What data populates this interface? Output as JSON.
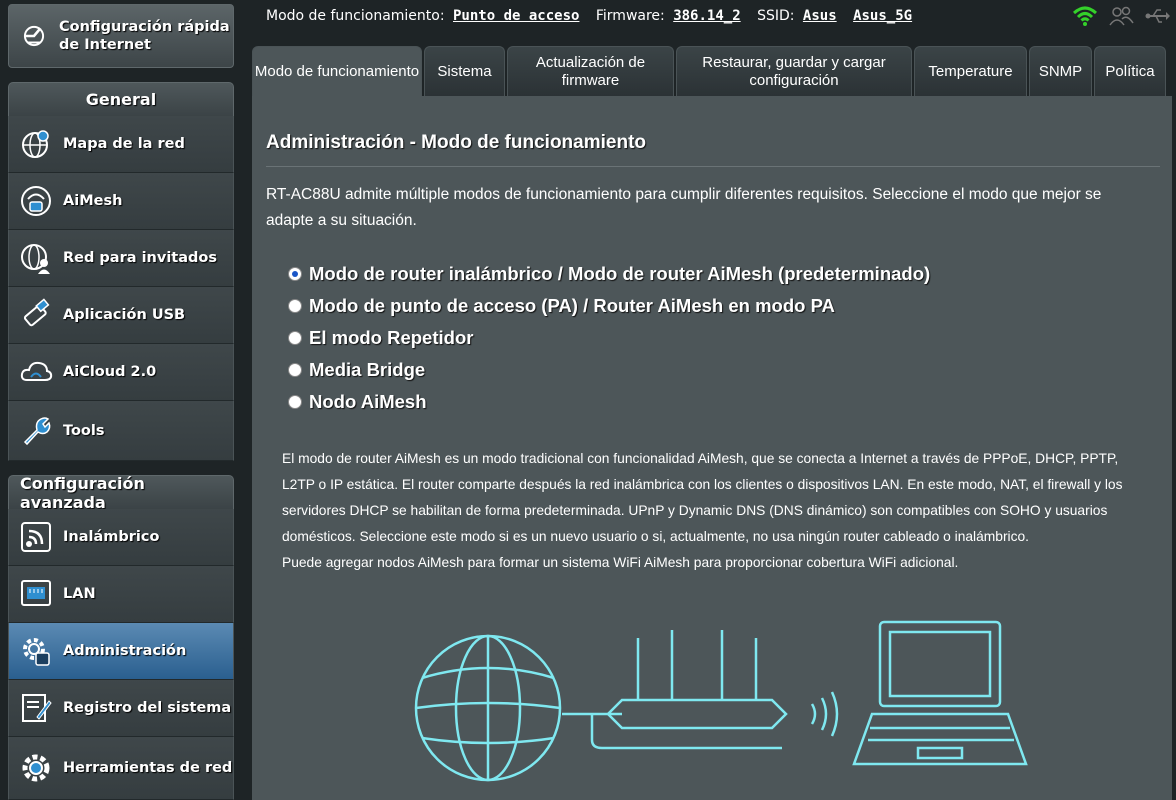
{
  "sidebar": {
    "quick_setup": "Configuración rápida de Internet",
    "general_header": "General",
    "general_items": [
      {
        "label": "Mapa de la red",
        "icon": "network-map-icon"
      },
      {
        "label": "AiMesh",
        "icon": "aimesh-icon"
      },
      {
        "label": "Red para invitados",
        "icon": "guest-network-icon"
      },
      {
        "label": "Aplicación USB",
        "icon": "usb-icon"
      },
      {
        "label": "AiCloud 2.0",
        "icon": "cloud-icon"
      },
      {
        "label": "Tools",
        "icon": "wrench-icon"
      }
    ],
    "advanced_header": "Configuración avanzada",
    "advanced_items": [
      {
        "label": "Inalámbrico",
        "icon": "wireless-icon"
      },
      {
        "label": "LAN",
        "icon": "lan-icon"
      },
      {
        "label": "Administración",
        "icon": "admin-icon",
        "active": true
      },
      {
        "label": "Registro del sistema",
        "icon": "system-log-icon"
      },
      {
        "label": "Herramientas de red",
        "icon": "network-tools-icon"
      }
    ]
  },
  "topbar": {
    "mode_label": "Modo de funcionamiento:",
    "mode_value": "Punto de acceso",
    "firmware_label": "Firmware:",
    "firmware_value": "386.14_2",
    "ssid_label": "SSID:",
    "ssid_1": "Asus",
    "ssid_2": "Asus_5G"
  },
  "tabs": [
    {
      "label": "Modo de funcionamiento",
      "active": true
    },
    {
      "label": "Sistema"
    },
    {
      "label": "Actualización de firmware"
    },
    {
      "label": "Restaurar, guardar y cargar configuración"
    },
    {
      "label": "Temperature"
    },
    {
      "label": "SNMP"
    },
    {
      "label": "Política"
    }
  ],
  "main": {
    "title": "Administración - Modo de funcionamiento",
    "description": "RT-AC88U admite múltiple modos de funcionamiento para cumplir diferentes requisitos. Seleccione el modo que mejor se adapte a su situación.",
    "modes": [
      {
        "label": "Modo de router inalámbrico / Modo de router AiMesh (predeterminado)",
        "checked": true
      },
      {
        "label": "Modo de punto de acceso (PA) / Router AiMesh en modo PA",
        "checked": false
      },
      {
        "label": "El modo Repetidor",
        "checked": false
      },
      {
        "label": "Media Bridge",
        "checked": false
      },
      {
        "label": "Nodo AiMesh",
        "checked": false
      }
    ],
    "mode_description": "El modo de router AiMesh es un modo tradicional con funcionalidad AiMesh, que se conecta a Internet a través de PPPoE, DHCP, PPTP, L2TP o IP estática. El router comparte después la red inalámbrica con los clientes o dispositivos LAN. En este modo, NAT, el firewall y los servidores DHCP se habilitan de forma predeterminada. UPnP y Dynamic DNS (DNS dinámico) son compatibles con SOHO y usuarios domésticos. Seleccione este modo si es un nuevo usuario o si, actualmente, no usa ningún router cableado o inalámbrico.",
    "mode_description_2": "Puede agregar nodos AiMesh para formar un sistema WiFi AiMesh para proporcionar cobertura WiFi adicional."
  },
  "colors": {
    "background": "#1e2426",
    "content": "#4d5659",
    "active_menu": "#2a5f8f",
    "wifi_green": "#34d12a",
    "illustration_cyan": "#7fe8f0"
  }
}
